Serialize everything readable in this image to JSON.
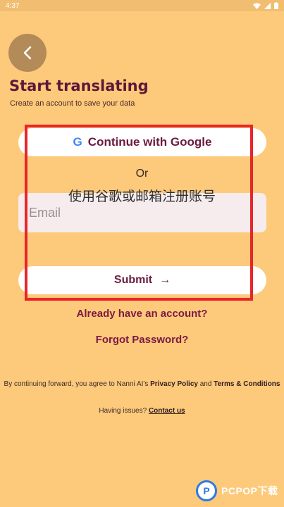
{
  "status_bar": {
    "time": "4:37"
  },
  "header": {
    "back_icon": "chevron-left-icon",
    "title": "Start translating",
    "subtitle": "Create an account to save your data"
  },
  "auth": {
    "google_button_label": "Continue with Google",
    "google_icon": "google-icon",
    "or_label": "Or",
    "email_placeholder": "Email",
    "submit_label": "Submit",
    "submit_arrow": "→"
  },
  "overlay": {
    "annotation_text": "使用谷歌或邮箱注册账号",
    "frame_color": "#e8262a"
  },
  "links": {
    "already_account": "Already have an account?",
    "forgot_password": "Forgot Password?"
  },
  "footer": {
    "terms_prefix": "By continuing forward, you agree to Nanni AI's",
    "privacy_policy": "Privacy Policy",
    "and_text": "and",
    "terms_conditions": "Terms & Conditions",
    "issues_prefix": "Having issues?",
    "contact_us": "Contact us"
  },
  "watermark": {
    "text": "PCPOP下载",
    "logo_letter": "P"
  },
  "colors": {
    "background": "#FDC97A",
    "accent": "#6b1a3f",
    "button_bg": "#ffffff"
  }
}
